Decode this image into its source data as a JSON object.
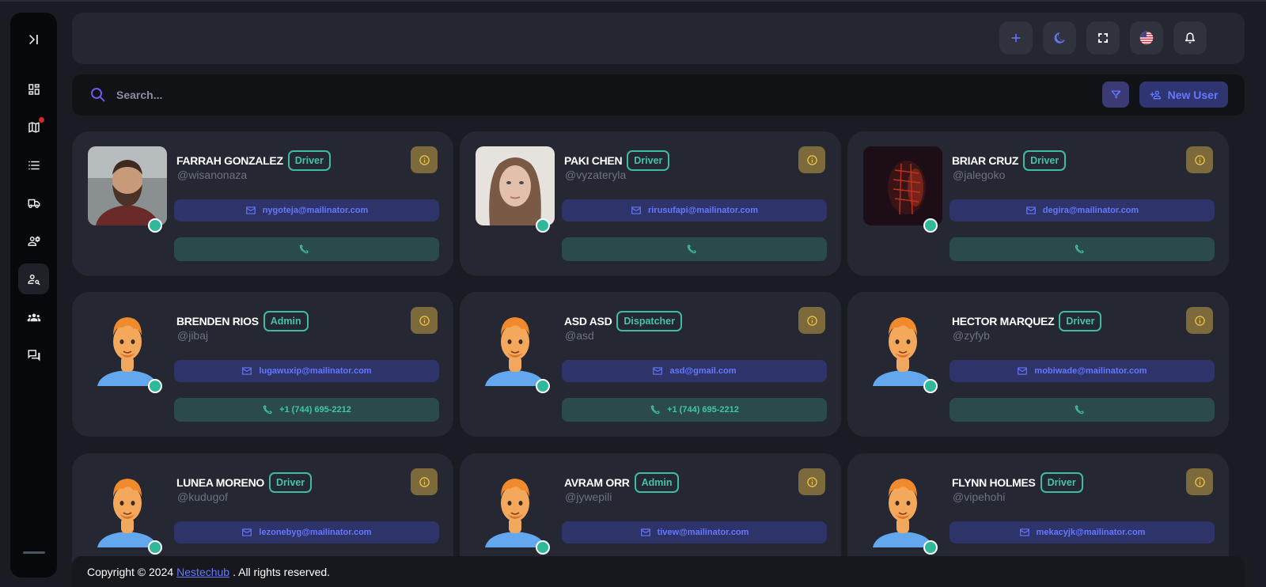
{
  "sidebar": {
    "items": [
      {
        "icon": "sidebar-toggle-icon"
      },
      {
        "icon": "dashboard-icon"
      },
      {
        "icon": "map-icon"
      },
      {
        "icon": "list-icon"
      },
      {
        "icon": "truck-icon"
      },
      {
        "icon": "user-settings-icon"
      },
      {
        "icon": "user-search-icon"
      },
      {
        "icon": "group-icon"
      },
      {
        "icon": "chat-icon"
      }
    ]
  },
  "header": {
    "buttons": [
      "plus-icon",
      "moon-icon",
      "fullscreen-icon",
      "us-flag-icon",
      "bell-icon"
    ]
  },
  "search": {
    "placeholder": "Search...",
    "new_user_label": "New User"
  },
  "colors": {
    "accent": "#6478ff",
    "role_green": "#43c4a7",
    "info_gold": "#7c6a3c"
  },
  "users": [
    {
      "name": "FARRAH GONZALEZ",
      "role": "Driver",
      "handle": "@wisanonaza",
      "email": "nygoteja@mailinator.com",
      "phone": "",
      "avatar": "photo-man-beard"
    },
    {
      "name": "PAKI CHEN",
      "role": "Driver",
      "handle": "@vyzateryla",
      "email": "rirusufapi@mailinator.com",
      "phone": "",
      "avatar": "photo-woman"
    },
    {
      "name": "BRIAR CRUZ",
      "role": "Driver",
      "handle": "@jalegoko",
      "email": "degira@mailinator.com",
      "phone": "",
      "avatar": "photo-red-light"
    },
    {
      "name": "BRENDEN RIOS",
      "role": "Admin",
      "handle": "@jibaj",
      "email": "lugawuxip@mailinator.com",
      "phone": "+1 (744) 695-2212",
      "avatar": "default-avatar"
    },
    {
      "name": "ASD ASD",
      "role": "Dispatcher",
      "handle": "@asd",
      "email": "asd@gmail.com",
      "phone": "+1 (744) 695-2212",
      "avatar": "default-avatar"
    },
    {
      "name": "HECTOR MARQUEZ",
      "role": "Driver",
      "handle": "@zyfyb",
      "email": "mobiwade@mailinator.com",
      "phone": "",
      "avatar": "default-avatar"
    },
    {
      "name": "LUNEA MORENO",
      "role": "Driver",
      "handle": "@kudugof",
      "email": "lezonebyg@mailinator.com",
      "phone": "",
      "avatar": "default-avatar"
    },
    {
      "name": "AVRAM ORR",
      "role": "Admin",
      "handle": "@jywepili",
      "email": "tivew@mailinator.com",
      "phone": "",
      "avatar": "default-avatar"
    },
    {
      "name": "FLYNN HOLMES",
      "role": "Driver",
      "handle": "@vipehohi",
      "email": "mekacyjk@mailinator.com",
      "phone": "",
      "avatar": "default-avatar"
    }
  ],
  "footer": {
    "prefix": "Copyright © 2024",
    "link": "Nestechub",
    "suffix": ". All rights reserved."
  }
}
